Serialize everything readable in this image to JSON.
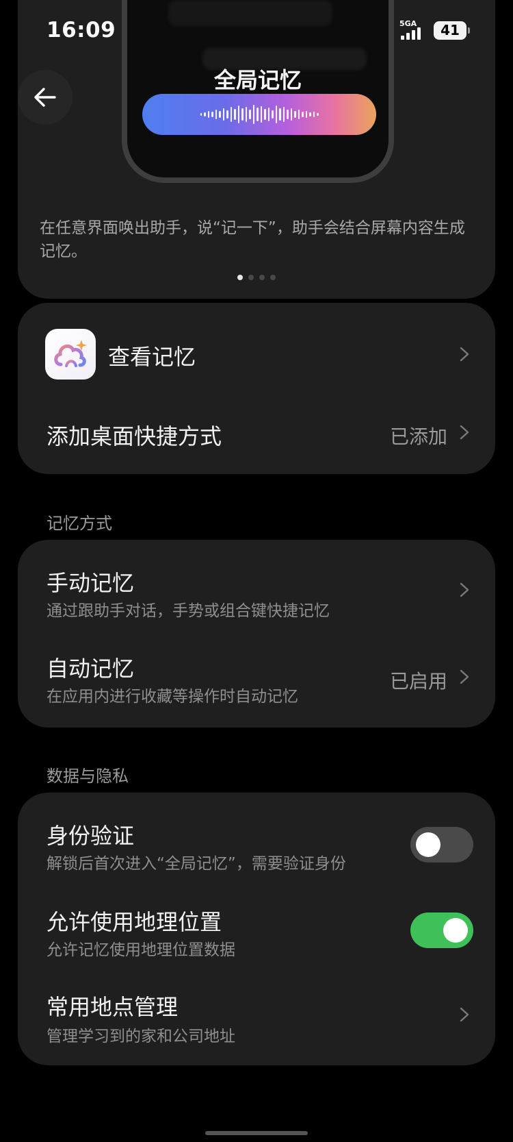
{
  "status_bar": {
    "time": "16:09",
    "network": "5GA",
    "battery": "41"
  },
  "hero": {
    "title": "全局记忆",
    "description": "在任意界面唤出助手，说“记一下”，助手会结合屏幕内容生成记忆。",
    "page_count": 4,
    "active_page": 1
  },
  "top_card": {
    "items": [
      {
        "label": "查看记忆",
        "icon": "cloud-sparkle-icon"
      },
      {
        "label": "添加桌面快捷方式",
        "value": "已添加"
      }
    ]
  },
  "memory_section": {
    "label": "记忆方式",
    "items": [
      {
        "title": "手动记忆",
        "subtitle": "通过跟助手对话，手势或组合键快捷记忆"
      },
      {
        "title": "自动记忆",
        "subtitle": "在应用内进行收藏等操作时自动记忆",
        "value": "已启用"
      }
    ]
  },
  "privacy_section": {
    "label": "数据与隐私",
    "items": [
      {
        "title": "身份验证",
        "subtitle": "解锁后首次进入“全局记忆”，需要验证身份",
        "toggle": false
      },
      {
        "title": "允许使用地理位置",
        "subtitle": "允许记忆使用地理位置数据",
        "toggle": true
      },
      {
        "title": "常用地点管理",
        "subtitle": "管理学习到的家和公司地址"
      }
    ]
  },
  "colors": {
    "background": "#000000",
    "card": "#1f1f1f",
    "toggle_on": "#3fc059",
    "toggle_off": "#4a4a4a"
  }
}
